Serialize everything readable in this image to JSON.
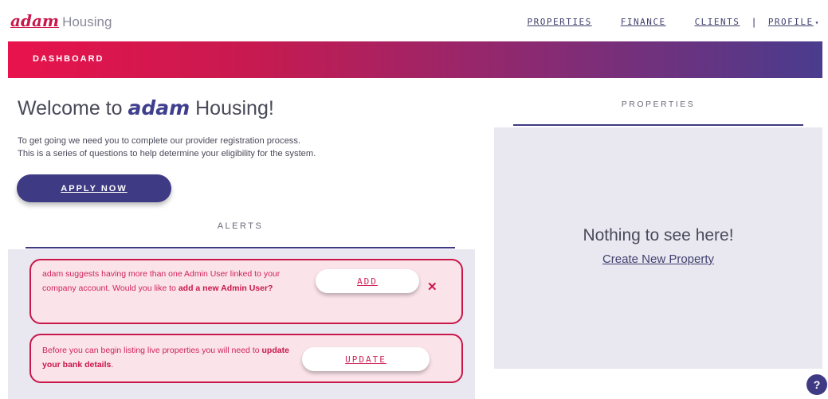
{
  "header": {
    "logo_script": "adam",
    "logo_word": "Housing",
    "nav": [
      "PROPERTIES",
      "FINANCE",
      "CLIENTS"
    ],
    "separator": "|",
    "profile_label": "PROFILE",
    "profile_caret": "▾"
  },
  "band": {
    "label": "DASHBOARD"
  },
  "welcome": {
    "title_prefix": "Welcome to ",
    "title_brand": "adam",
    "title_suffix": " Housing!",
    "line1": "To get going we need you to complete our provider registration process.",
    "line2": "This is a series of questions to help determine your eligibility for the system.",
    "apply_label": "APPLY NOW"
  },
  "alerts": {
    "heading": "ALERTS",
    "items": [
      {
        "text": "adam suggests having more than one Admin User linked to your company account. Would you like to ",
        "bold": "add a new Admin User?",
        "suffix": "",
        "button": "ADD",
        "close": "✕"
      },
      {
        "text": "Before you can begin listing live properties you will need to ",
        "bold": "update your bank details",
        "suffix": ".",
        "button": "UPDATE"
      }
    ]
  },
  "properties": {
    "heading": "PROPERTIES",
    "empty_title": "Nothing to see here!",
    "create_link": "Create New Property"
  },
  "help": {
    "label": "?"
  },
  "colors": {
    "brand_pink": "#c8184a",
    "brand_indigo": "#3e3a83",
    "panel_bg": "#e9e8f1",
    "alert_bg": "#fbe3ea"
  }
}
